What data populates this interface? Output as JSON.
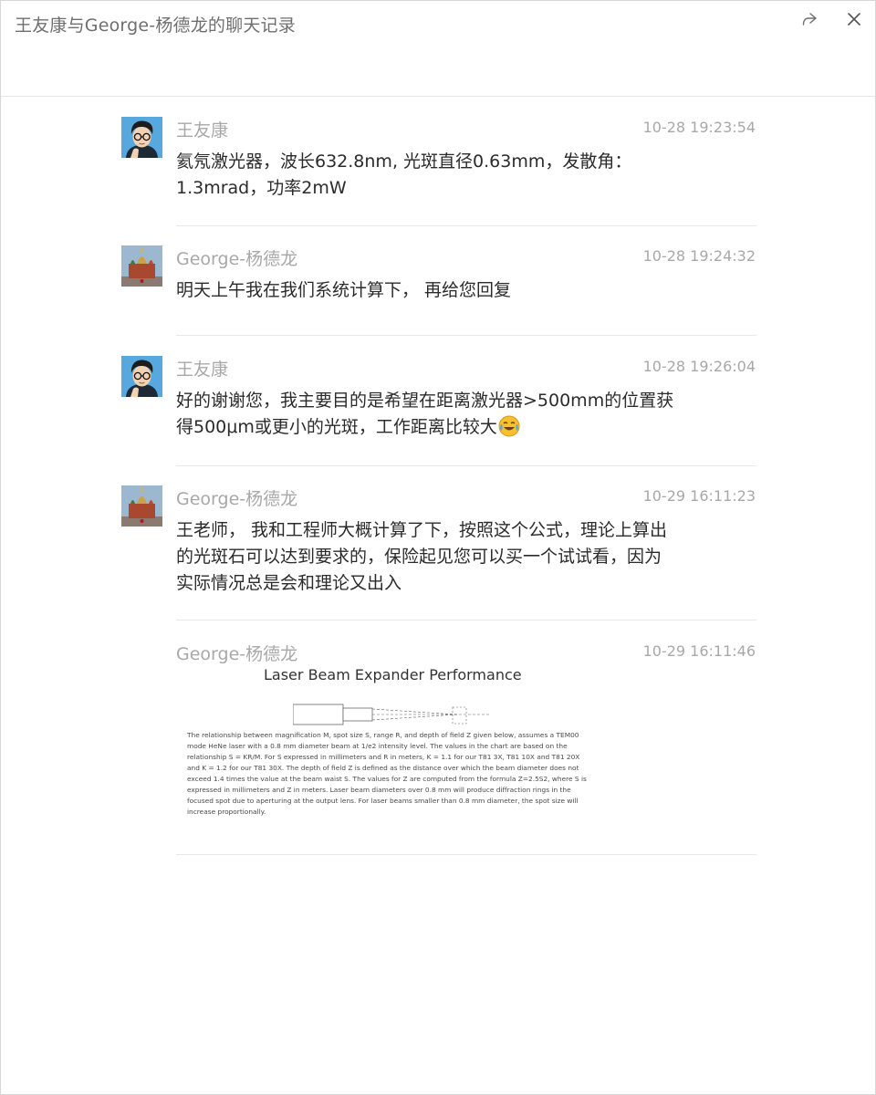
{
  "window": {
    "title": "王友康与George-杨德龙的聊天记录",
    "share_icon": "share-forward-icon",
    "close_icon": "close-icon"
  },
  "messages": [
    {
      "sender": "王友康",
      "time": "10-28 19:23:54",
      "avatar": "cartoon-avatar-glasses",
      "lines": [
        "氦氖激光器，波长632.8nm, 光斑直径0.63mm，发散角：",
        "1.3mrad，功率2mW"
      ]
    },
    {
      "sender": "George-杨德龙",
      "time": "10-28 19:24:32",
      "avatar": "photo-avatar-cathedral",
      "lines": [
        "明天上午我在我们系统计算下， 再给您回复"
      ]
    },
    {
      "sender": "王友康",
      "time": "10-28 19:26:04",
      "avatar": "cartoon-avatar-glasses",
      "lines": [
        "好的谢谢您，我主要目的是希望在距离激光器>500mm的位置获",
        "得500μm或更小的光斑，工作距离比较大"
      ],
      "emoji": "laughing-crying-emoji"
    },
    {
      "sender": "George-杨德龙",
      "time": "10-29 16:11:23",
      "avatar": "photo-avatar-cathedral",
      "lines": [
        "王老师， 我和工程师大概计算了下，按照这个公式，理论上算出",
        "的光斑石可以达到要求的，保险起见您可以买一个试试看，因为",
        "实际情况总是会和理论又出入"
      ]
    },
    {
      "sender": "George-杨德龙",
      "time": "10-29 16:11:46",
      "attachment": {
        "title": "Laser Beam Expander Performance",
        "body": "The relationship between magnification M, spot size S, range R, and depth of field Z given below, assumes a TEM00 mode HeNe laser with a 0.8 mm diameter beam at 1/e2 intensity level. The values in the chart are based on the relationship S = KR/M. For S expressed in millimeters and R in meters, K = 1.1 for our T81 3X, T81 10X and T81 20X and K = 1.2 for our T81 30X. The depth of field Z is defined as the distance over which the beam diameter does not exceed 1.4 times the value at the beam waist S. The values for Z are computed from the formula Z=2.5S2, where S is expressed in millimeters and Z in meters. Laser beam diameters over 0.8 mm will produce diffraction rings in the focused spot due to aperturing at the output lens. For laser beams smaller than 0.8 mm diameter, the spot size will increase proportionally."
      }
    }
  ]
}
